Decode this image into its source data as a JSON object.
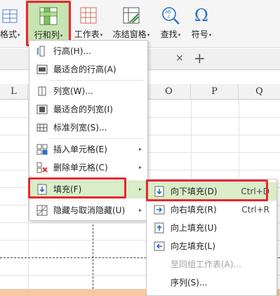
{
  "ribbon": {
    "format_label": "格式",
    "row_col_label": "行和列",
    "worksheet_label": "工作表",
    "freeze_label": "冻结窗格",
    "find_label": "查找",
    "symbol_label": "符号",
    "ab_glyph": "ab",
    "c_glyph": "c",
    "omega_glyph": "Ω",
    "arrow": "▾"
  },
  "tabbar": {
    "close": "×",
    "add": "+"
  },
  "sheet": {
    "columns": [
      "L",
      "O",
      "P",
      "Q"
    ]
  },
  "row_col_menu": {
    "items": [
      {
        "label": "行高(H)..."
      },
      {
        "label": "最适合的行高(A)"
      },
      {
        "label": "列宽(W)..."
      },
      {
        "label": "最适合的列宽(I)"
      },
      {
        "label": "标准列宽(S)..."
      },
      {
        "label": "插入单元格(E)"
      },
      {
        "label": "删除单元格(C)"
      },
      {
        "label": "填充(F)"
      },
      {
        "label": "隐藏与取消隐藏(U)"
      }
    ],
    "submenu_arrow": "▸"
  },
  "fill_submenu": {
    "items": [
      {
        "label": "向下填充(D)",
        "shortcut": "Ctrl+D"
      },
      {
        "label": "向右填充(R)",
        "shortcut": "Ctrl+R"
      },
      {
        "label": "向上填充(U)",
        "shortcut": ""
      },
      {
        "label": "向左填充(L)",
        "shortcut": ""
      },
      {
        "label": "至同组工作表(A)...",
        "shortcut": ""
      },
      {
        "label": "序列(S)...",
        "shortcut": ""
      }
    ]
  },
  "colors": {
    "highlight": "#d8edc8",
    "active_button": "#c7e4b3",
    "callout_red": "#e8272d",
    "accent_blue": "#2b6fc4"
  }
}
